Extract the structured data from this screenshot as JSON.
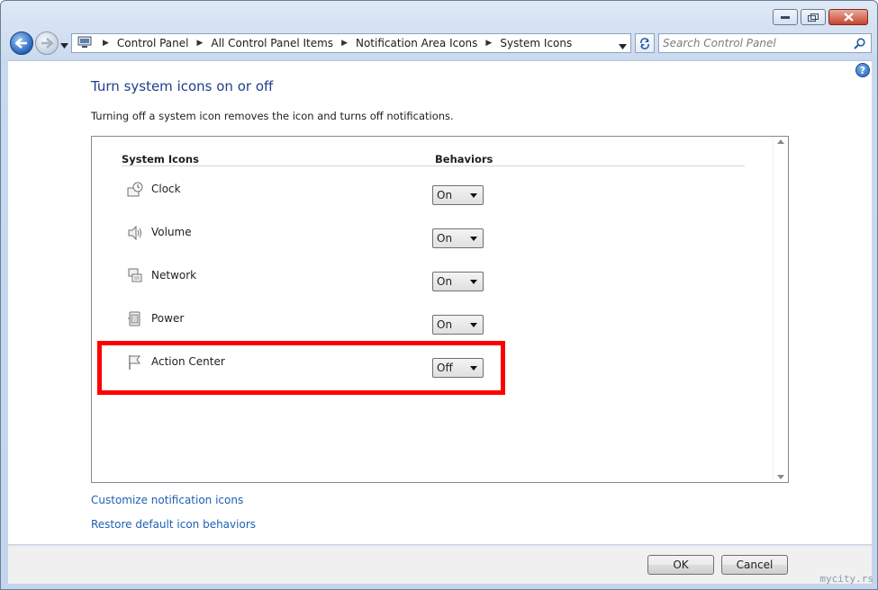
{
  "titlebar": {
    "minimize": "minimize",
    "maximize": "maximize",
    "close": "close"
  },
  "nav": {
    "breadcrumbs": [
      "Control Panel",
      "All Control Panel Items",
      "Notification Area Icons",
      "System Icons"
    ],
    "search_placeholder": "Search Control Panel"
  },
  "page": {
    "title": "Turn system icons on or off",
    "description": "Turning off a system icon removes the icon and turns off notifications.",
    "help": "?"
  },
  "table": {
    "col_icons": "System Icons",
    "col_behaviors": "Behaviors",
    "rows": [
      {
        "name": "Clock",
        "icon": "clock-icon",
        "value": "On"
      },
      {
        "name": "Volume",
        "icon": "volume-icon",
        "value": "On"
      },
      {
        "name": "Network",
        "icon": "network-icon",
        "value": "On"
      },
      {
        "name": "Power",
        "icon": "power-icon",
        "value": "On"
      },
      {
        "name": "Action Center",
        "icon": "flag-icon",
        "value": "Off"
      }
    ]
  },
  "links": {
    "customize": "Customize notification icons",
    "restore": "Restore default icon behaviors"
  },
  "buttons": {
    "ok": "OK",
    "cancel": "Cancel"
  },
  "watermark": "mycity.rs",
  "colors": {
    "highlight": "#ff0000",
    "link": "#1e5fb3",
    "title": "#1e3f8c"
  }
}
